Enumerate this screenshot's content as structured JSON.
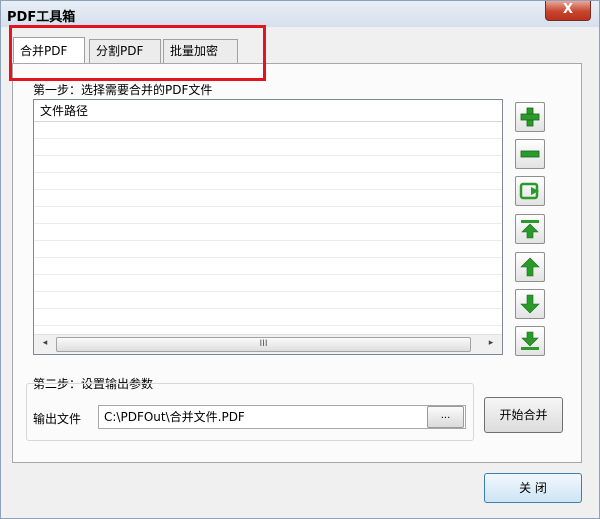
{
  "window": {
    "title": "PDF工具箱",
    "close_label": "X"
  },
  "tabs": [
    {
      "label": "合并PDF"
    },
    {
      "label": "分割PDF"
    },
    {
      "label": "批量加密"
    }
  ],
  "step1": {
    "label": "第一步：选择需要合并的PDF文件"
  },
  "file_list": {
    "column_header": "文件路径",
    "rows": []
  },
  "scrollbar": {
    "left": "◂",
    "thumb": "III",
    "right": "▸"
  },
  "side_buttons": [
    {
      "name": "add-file-button",
      "icon": "plus-icon"
    },
    {
      "name": "remove-file-button",
      "icon": "minus-icon"
    },
    {
      "name": "clear-list-button",
      "icon": "reload-icon"
    },
    {
      "name": "move-top-button",
      "icon": "arrow-top-icon"
    },
    {
      "name": "move-up-button",
      "icon": "arrow-up-icon"
    },
    {
      "name": "move-down-button",
      "icon": "arrow-down-icon"
    },
    {
      "name": "move-bottom-button",
      "icon": "arrow-bottom-icon"
    }
  ],
  "step2": {
    "label": "第二步：设置输出参数",
    "output_label": "输出文件",
    "output_value": "C:\\PDFOut\\合并文件.PDF",
    "browse_label": "..."
  },
  "actions": {
    "start_label": "开始合并",
    "close_label": "关 闭"
  },
  "colors": {
    "accent_green": "#2a9a2a",
    "highlight_red": "#e2141e"
  }
}
